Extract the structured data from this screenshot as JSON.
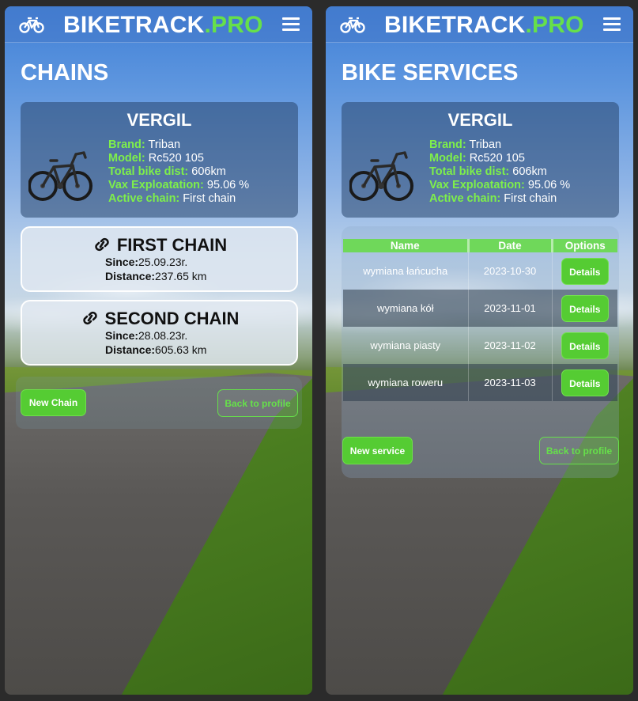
{
  "app": {
    "brand_main": "BIKETRACK",
    "brand_accent": ".PRO",
    "accent_color": "#66e04a"
  },
  "chains_screen": {
    "title": "CHAINS",
    "bike": {
      "name": "VERGIL",
      "brand_label": "Brand:",
      "brand_value": "Triban",
      "model_label": "Model:",
      "model_value": "Rc520 105",
      "dist_label": "Total bike dist:",
      "dist_value": "606km",
      "vax_label": "Vax Exploatation:",
      "vax_value": "95.06 %",
      "active_label": "Active chain:",
      "active_value": "First chain"
    },
    "chains": [
      {
        "name": "FIRST CHAIN",
        "since_label": "Since:",
        "since_value": "25.09.23r.",
        "distance_label": "Distance:",
        "distance_value": "237.65 km"
      },
      {
        "name": "SECOND CHAIN",
        "since_label": "Since:",
        "since_value": "28.08.23r.",
        "distance_label": "Distance:",
        "distance_value": "605.63 km"
      }
    ],
    "new_button": "New Chain",
    "back_button": "Back to profile"
  },
  "services_screen": {
    "title": "BIKE SERVICES",
    "bike": {
      "name": "VERGIL",
      "brand_label": "Brand:",
      "brand_value": "Triban",
      "model_label": "Model:",
      "model_value": "Rc520 105",
      "dist_label": "Total bike dist:",
      "dist_value": "606km",
      "vax_label": "Vax Exploatation:",
      "vax_value": "95.06 %",
      "active_label": "Active chain:",
      "active_value": "First chain"
    },
    "table": {
      "headers": [
        "Name",
        "Date",
        "Options"
      ],
      "rows": [
        {
          "name": "wymiana łańcucha",
          "date": "2023-10-30",
          "action": "Details"
        },
        {
          "name": "wymiana kół",
          "date": "2023-11-01",
          "action": "Details"
        },
        {
          "name": "wymiana piasty",
          "date": "2023-11-02",
          "action": "Details"
        },
        {
          "name": "wymiana roweru",
          "date": "2023-11-03",
          "action": "Details"
        }
      ]
    },
    "new_button": "New service",
    "back_button": "Back to profile"
  }
}
